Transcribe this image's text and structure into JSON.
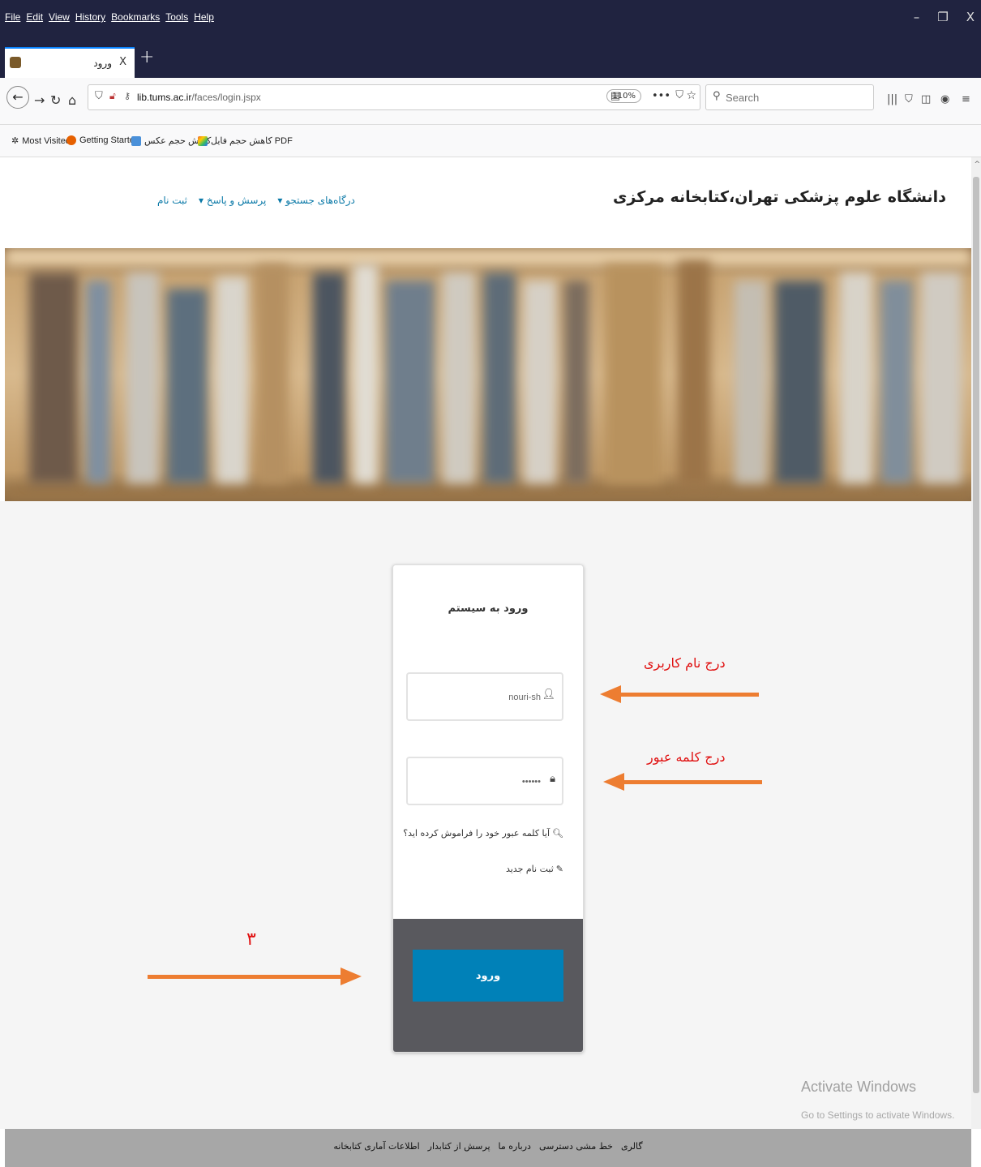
{
  "browser": {
    "menu": [
      "File",
      "Edit",
      "View",
      "History",
      "Bookmarks",
      "Tools",
      "Help"
    ],
    "window_controls": {
      "minimize": "–",
      "restore": "❐",
      "close": "X"
    },
    "tab": {
      "title": "ورود",
      "close": "X"
    },
    "new_tab": "+",
    "url": {
      "domain": "lib.tums.ac.ir",
      "path": "/faces/login.jspx"
    },
    "zoom": "110%",
    "more": "•••",
    "search_placeholder": "Search",
    "bookmarks": [
      {
        "label": "Most Visited",
        "icon": "gear-icon"
      },
      {
        "label": "Getting Started",
        "icon": "firefox-icon"
      },
      {
        "label": "کاهش حجم عکس",
        "icon": "image-icon"
      },
      {
        "label": "کاهش حجم فایل PDF",
        "icon": "pdf-icon"
      }
    ]
  },
  "site": {
    "title": "دانشگاه علوم پزشکی تهران،کتابخانه مرکزی",
    "nav": [
      {
        "label": "درگاه‌های جستجو ▾"
      },
      {
        "label": "پرسش و پاسخ ▾"
      },
      {
        "label": "ثبت نام"
      }
    ]
  },
  "login": {
    "title": "ورود به سیستم",
    "username_value": "nouri-sh",
    "password_value": "••••••",
    "forgot_link": "آیا کلمه عبور خود را فراموش کرده اید؟",
    "register_link": "ثبت نام جدید",
    "submit_label": "ورود"
  },
  "annotations": {
    "username_hint": "درج نام کاربری",
    "password_hint": "درج کلمه عبور",
    "step_number": "۳",
    "arrow_color": "#ed7d31",
    "text_color": "#e01010"
  },
  "watermark": {
    "title": "Activate Windows",
    "subtitle": "Go to Settings to activate Windows."
  },
  "footer": {
    "links": [
      "گالری",
      "خط مشی دسترسی",
      "درباره ما",
      "پرسش از کتابدار",
      "اطلاعات آماری کتابخانه"
    ]
  }
}
